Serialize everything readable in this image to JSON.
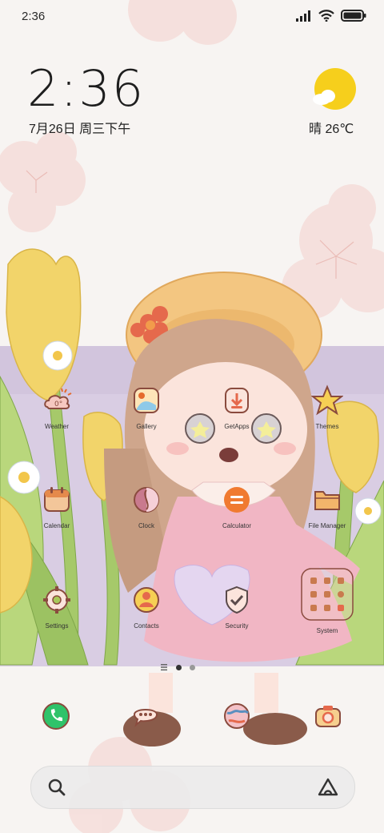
{
  "status_bar": {
    "time": "2:36"
  },
  "clock_widget": {
    "time": "2:36",
    "date": "7月26日 周三下午"
  },
  "weather_widget": {
    "text": "晴 26℃",
    "icon": "sunny-partly-cloudy-icon"
  },
  "apps": [
    {
      "label": "Weather",
      "icon": "weather-icon"
    },
    {
      "label": "Gallery",
      "icon": "gallery-icon"
    },
    {
      "label": "GetApps",
      "icon": "getapps-icon"
    },
    {
      "label": "Themes",
      "icon": "themes-icon"
    },
    {
      "label": "Calendar",
      "icon": "calendar-icon"
    },
    {
      "label": "Clock",
      "icon": "clock-icon"
    },
    {
      "label": "Calculator",
      "icon": "calculator-icon"
    },
    {
      "label": "File Manager",
      "icon": "file-manager-icon"
    },
    {
      "label": "Settings",
      "icon": "settings-icon"
    },
    {
      "label": "Contacts",
      "icon": "contacts-icon"
    },
    {
      "label": "Security",
      "icon": "security-icon"
    },
    {
      "label": "System",
      "icon": "system-folder-icon"
    }
  ],
  "page_indicator": {
    "pages": 2,
    "current": 1
  },
  "dock": [
    "phone-icon",
    "messages-icon",
    "browser-icon",
    "camera-icon"
  ],
  "search_bar": {
    "search_icon": "search-icon",
    "assistant_icon": "assistant-icon"
  },
  "colors": {
    "accent": "#e56a2c",
    "sun": "#f6cf1c",
    "tulip": "#f2d46a",
    "dress": "#f1b6c4"
  }
}
